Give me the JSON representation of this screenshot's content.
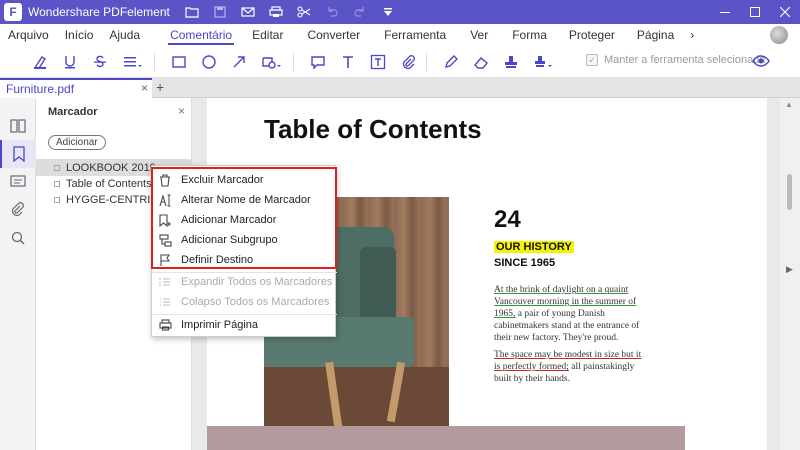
{
  "titlebar": {
    "app_title": "Wondershare PDFelement",
    "logo_letter": "F"
  },
  "menu": {
    "items": [
      "Arquivo",
      "Início",
      "Ajuda",
      "Comentário",
      "Editar",
      "Converter",
      "Ferramenta",
      "Ver",
      "Forma",
      "Proteger",
      "Página"
    ],
    "active": "Comentário",
    "more_icon": "chevron-right-icon"
  },
  "toolbar": {
    "keep_tool_label": "Manter a ferramenta selecionada",
    "keep_tool_checked": false
  },
  "tabs": {
    "document_tab": "Furniture.pdf"
  },
  "bookmarks": {
    "title": "Marcador",
    "add_button": "Adicionar",
    "items": [
      "LOOKBOOK 2019",
      "Table of Contents",
      "HYGGE-CENTRIC D"
    ]
  },
  "context_menu": {
    "items": [
      {
        "label": "Excluir Marcador",
        "icon": "trash-icon",
        "enabled": true
      },
      {
        "label": "Alterar Nome de Marcador",
        "icon": "rename-icon",
        "enabled": true
      },
      {
        "label": "Adicionar Marcador",
        "icon": "add-bookmark-icon",
        "enabled": true
      },
      {
        "label": "Adicionar Subgrupo",
        "icon": "add-subgroup-icon",
        "enabled": true
      },
      {
        "label": "Definir Destino",
        "icon": "flag-icon",
        "enabled": true
      },
      {
        "label": "Expandir Todos os Marcadores",
        "icon": "expand-list-icon",
        "enabled": false
      },
      {
        "label": "Colapso Todos os Marcadores",
        "icon": "collapse-list-icon",
        "enabled": false
      },
      {
        "label": "Imprimir Página",
        "icon": "print-icon",
        "enabled": true
      }
    ]
  },
  "page": {
    "title": "Table of Contents",
    "number": "24",
    "our_history": "OUR HISTORY",
    "since": "SINCE 1965",
    "para1_underlined": "At the brink of daylight on a quaint Vancouver morning in the summer of 1965,",
    "para1_rest": " a pair of young Danish cabinetmakers stand at the entrance of their new factory. They're proud.",
    "para2_strike": "The space may be modest in size but it is perfectly formed;",
    "para2_rest": " all painstakingly built by their hands."
  },
  "colors": {
    "brand": "#5b54c7",
    "accent": "#4b47c8",
    "highlight_box": "#e02020",
    "text_highlight": "#f5f500"
  }
}
